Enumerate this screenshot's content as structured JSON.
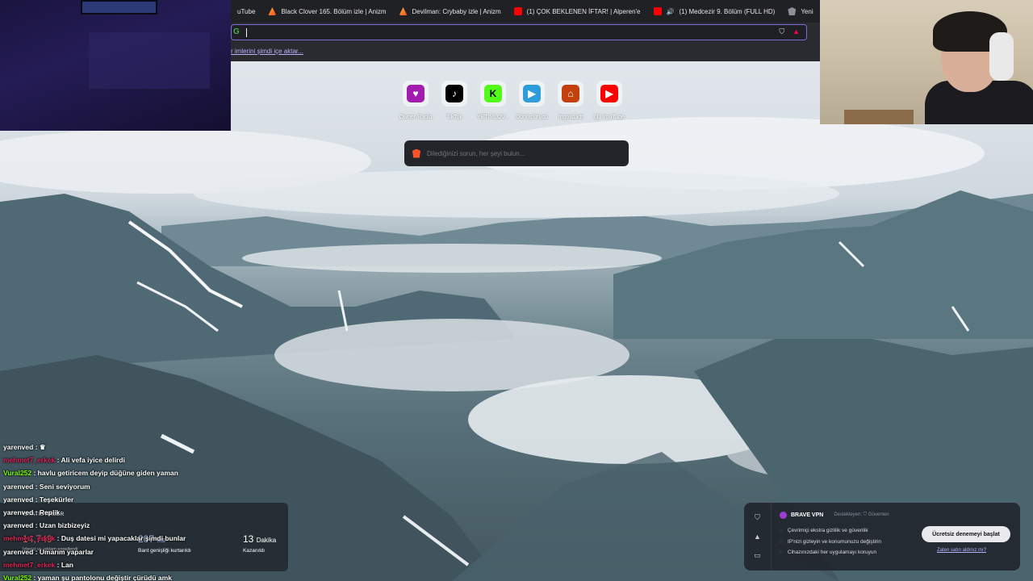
{
  "tabs": [
    {
      "label": "uTube",
      "icon": "youtube-icon"
    },
    {
      "label": "Black Clover 165. Bölüm izle | Anizm",
      "icon": "anizm-icon"
    },
    {
      "label": "Devilman: Crybaby izle | Anizm",
      "icon": "anizm-icon"
    },
    {
      "label": "(1) ÇOK BEKLENEN İFTAR! | Alperen'e",
      "icon": "youtube-icon"
    },
    {
      "label": "(1) Medcezir 9. Bölüm (FULL HD)",
      "icon": "youtube-icon"
    },
    {
      "label": "Yeni",
      "icon": "brave-icon"
    }
  ],
  "omnibox": {
    "value": ""
  },
  "bookmarks": {
    "import_link": "r imlerini şimdi içe aktar..."
  },
  "speed_dial": [
    {
      "label": "Owner Radio",
      "color": "#a21caf",
      "glyph": "♥"
    },
    {
      "label": "TikTok",
      "color": "#000000",
      "glyph": "♪"
    },
    {
      "label": "YETIMLOV...",
      "color": "#53fc18",
      "glyph": "K"
    },
    {
      "label": "Dönüştürücü",
      "color": "#2d9cdb",
      "glyph": "▶"
    },
    {
      "label": "İngolstadt",
      "color": "#c2410c",
      "glyph": "⌂"
    },
    {
      "label": "(1) YouTube",
      "color": "#ff0000",
      "glyph": "▶"
    }
  ],
  "search": {
    "placeholder": "Dilediğinizi sorun, her şeyi bulun..."
  },
  "chat": [
    {
      "user": "yarenved",
      "color": "#ffffff",
      "text": " : ♛"
    },
    {
      "user": "mehmet7_erkek",
      "color": "#e0245e",
      "text": " : Ali vefa iyice delirdi"
    },
    {
      "user": "Vural252",
      "color": "#7CFC00",
      "text": " : havlu getiricem deyip düğüne giden yaman"
    },
    {
      "user": "yarenved",
      "color": "#ffffff",
      "text": " : Seni seviyorum"
    },
    {
      "user": "yarenved",
      "color": "#ffffff",
      "text": " : Teşekürler"
    },
    {
      "user": "yarenved",
      "color": "#ffffff",
      "text": " : Replik"
    },
    {
      "user": "yarenved",
      "color": "#ffffff",
      "text": " : Uzan bizbizeyiz"
    },
    {
      "user": "mehmet7_erkek",
      "color": "#e0245e",
      "text": " : Duş datesi mi yapacaklar şimdi bunlar"
    },
    {
      "user": "yarenved",
      "color": "#ffffff",
      "text": " : Umarım yaparlar"
    },
    {
      "user": "mehmet7_erkek",
      "color": "#e0245e",
      "text": " : Lan"
    },
    {
      "user": "Vural252",
      "color": "#7CFC00",
      "text": " : yaman şu pantolonu değiştir çürüdü amk"
    }
  ],
  "stats": {
    "header": "İSTATİSTİKLER",
    "trackers_value": "14,749",
    "trackers_label": "İzleyici ve reklam engellendi",
    "bandwidth_value": "207",
    "bandwidth_unit": "MB",
    "bandwidth_label": "Bant genişliği kurtarıldı",
    "time_value": "13",
    "time_unit": "Dakika",
    "time_label": "Kazanıldı"
  },
  "vpn": {
    "title": "BRAVE VPN",
    "supported": "Destekleyen: ⛉ Güvenlen",
    "features": [
      "Çevrimiçi ekstra gizlilik ve güvenlik",
      "IP'nizi gizleyin ve konumunuzu değiştirin",
      "Cihazınızdaki her uygulamayı koruyun"
    ],
    "cta": "Ücretsiz denemeyi başlat",
    "purchased_link": "Zaten satın aldınız mı?"
  },
  "colors": {
    "accent": "#7d6bd6",
    "brave": "#fb542b"
  }
}
